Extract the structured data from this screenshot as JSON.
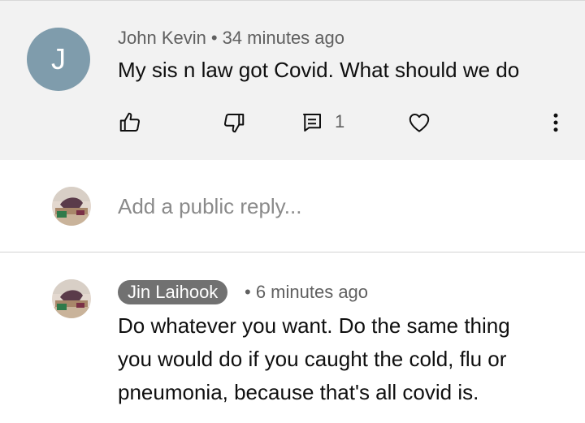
{
  "comment": {
    "avatar_letter": "J",
    "avatar_color": "#7f9cac",
    "author": "John Kevin",
    "separator": "•",
    "time": "34 minutes ago",
    "text": "My sis n law got Covid. What should we do",
    "reply_count": "1",
    "icons": [
      "thumb-up-icon",
      "thumb-down-icon",
      "reply-icon",
      "heart-icon",
      "more-vert-icon"
    ]
  },
  "reply_box": {
    "placeholder": "Add a public reply..."
  },
  "reply": {
    "author": "Jin Laihook",
    "separator": "•",
    "time": "6 minutes ago",
    "lines": [
      "Do whatever you want. Do the same thing",
      "you would do if you caught the cold, flu or",
      "pneumonia, because that's all covid is."
    ]
  }
}
